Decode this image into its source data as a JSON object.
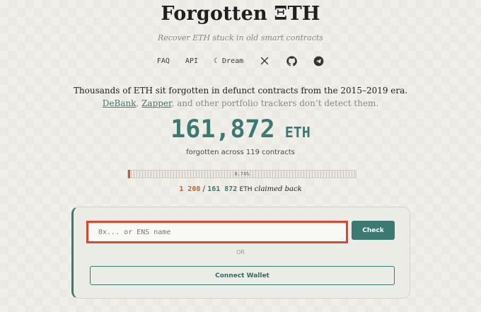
{
  "header": {
    "title": "Forgotten ΞTH",
    "subtitle": "Recover ETH stuck in old smart contracts"
  },
  "nav": {
    "faq": "FAQ",
    "api": "API",
    "theme": "☾ Dream",
    "icons": [
      "x-icon",
      "github-icon",
      "telegram-icon"
    ]
  },
  "intro": {
    "line1": "Thousands of ETH sit forgotten in defunct contracts from the 2015–2019 era.",
    "link_debank": "DeBank",
    "sep": ", ",
    "link_zapper": "Zapper",
    "line2_rest": ", and other portfolio trackers don’t detect them."
  },
  "stats": {
    "total": "161,872",
    "unit": "ETH",
    "forgotten_text": "forgotten across 119 contracts",
    "progress_label": "0.74%",
    "progress_fraction": 0.0074,
    "claimed_amount": "1 208",
    "slash": " / ",
    "total_amount": "161 872",
    "claimed_unit": "ETH",
    "claimed_text": "claimed back"
  },
  "form": {
    "placeholder": "0x... or ENS name",
    "value": "",
    "check_label": "Check",
    "or_label": "OR",
    "connect_label": "Connect Wallet"
  },
  "colors": {
    "accent": "#3b7a72",
    "claimed": "#b8652c",
    "highlight": "#e0442a"
  }
}
